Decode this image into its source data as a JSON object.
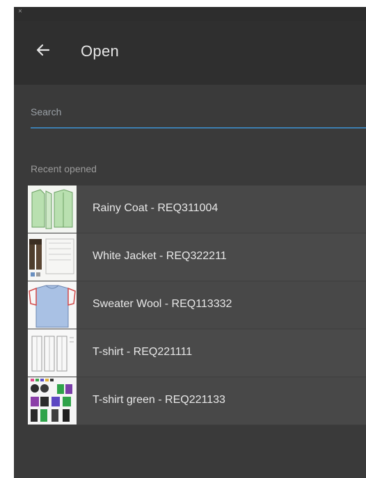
{
  "window": {
    "close_glyph": "×"
  },
  "header": {
    "title": "Open",
    "back_icon": "arrow-left-icon"
  },
  "search": {
    "placeholder": "Search",
    "value": ""
  },
  "recent": {
    "label": "Recent opened",
    "items": [
      {
        "label": "Rainy Coat - REQ311004",
        "thumb": "green-coat"
      },
      {
        "label": "White Jacket - REQ322211",
        "thumb": "jacket-sketch"
      },
      {
        "label": "Sweater Wool - REQ113332",
        "thumb": "blue-sweater"
      },
      {
        "label": "T-shirt - REQ221111",
        "thumb": "tshirt-sketch"
      },
      {
        "label": "T-shirt green - REQ221133",
        "thumb": "color-swatches"
      }
    ]
  },
  "colors": {
    "accent": "#3c7fb1",
    "header_bg": "#2f2f2f",
    "panel_bg": "#3a3a3a",
    "row_bg": "#4a4a4a"
  }
}
